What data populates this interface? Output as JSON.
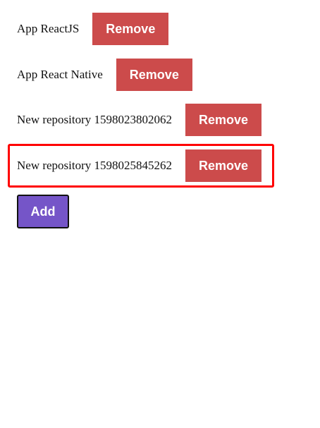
{
  "repositories": [
    {
      "name": "App ReactJS",
      "remove_label": "Remove"
    },
    {
      "name": "App React Native",
      "remove_label": "Remove"
    },
    {
      "name": "New repository 1598023802062",
      "remove_label": "Remove"
    },
    {
      "name": "New repository 1598025845262",
      "remove_label": "Remove"
    }
  ],
  "add_button": {
    "label": "Add"
  },
  "highlight": {
    "color": "#ff0000"
  },
  "colors": {
    "remove_button": "#cc4b4b",
    "add_button": "#7555c8"
  }
}
